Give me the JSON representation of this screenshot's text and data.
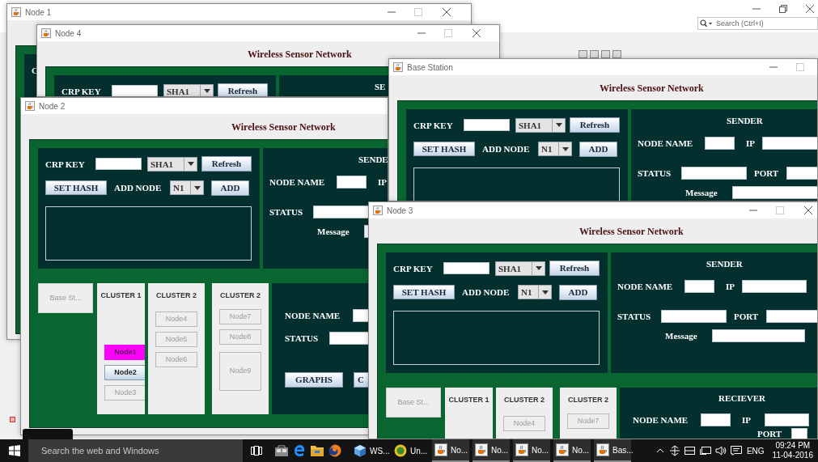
{
  "background_window": {
    "search": {
      "placeholder": "Search (Ctrl+I)"
    }
  },
  "windows": [
    {
      "title": "Node 1",
      "crp": {
        "key_label": "C"
      }
    },
    {
      "title": "Node 4",
      "heading": "Wireless Sensor Network",
      "crp": {
        "key_label": "CRP KEY",
        "hash_combo": "SHA1",
        "refresh_button": "Refresh"
      },
      "sender": {
        "title": "SE"
      }
    },
    {
      "title": "Node 2",
      "heading": "Wireless Sensor Network",
      "crp": {
        "key_label": "CRP KEY",
        "hash_combo": "SHA1",
        "refresh_button": "Refresh",
        "set_hash_button": "SET HASH",
        "add_node_label": "ADD NODE",
        "node_combo": "N1",
        "add_button": "ADD"
      },
      "sender": {
        "title": "SENDE",
        "node_name_label": "NODE NAME",
        "ip_label": "IP",
        "status_label": "STATUS",
        "message_label": "Message"
      },
      "bottom": {
        "base_button": "Base St...",
        "clusters": [
          {
            "title": "CLUSTER 1",
            "nodes": [
              {
                "label": "Node1",
                "highlighted": true,
                "disabled": false,
                "kind": "normal"
              },
              {
                "label": "Node2",
                "highlighted": false,
                "disabled": false,
                "kind": "normal"
              },
              {
                "label": "Node3",
                "highlighted": false,
                "disabled": true,
                "kind": "normal"
              }
            ]
          },
          {
            "title": "CLUSTER 2",
            "nodes": [
              {
                "label": "Node4",
                "highlighted": false,
                "disabled": true,
                "kind": "normal"
              },
              {
                "label": "Node5",
                "highlighted": false,
                "disabled": true,
                "kind": "normal"
              },
              {
                "label": "Node6",
                "highlighted": false,
                "disabled": true,
                "kind": "normal"
              }
            ]
          },
          {
            "title": "CLUSTER 2",
            "nodes": [
              {
                "label": "Node7",
                "highlighted": false,
                "disabled": true,
                "kind": "normal"
              },
              {
                "label": "Node8",
                "highlighted": false,
                "disabled": true,
                "kind": "normal"
              },
              {
                "label": "Node9",
                "highlighted": false,
                "disabled": true,
                "kind": "tall"
              }
            ]
          }
        ],
        "receiver": {
          "node_name_label": "NODE NAME",
          "status_label": "STATUS",
          "graphs_button": "GRAPHS",
          "other_button": "C"
        }
      }
    },
    {
      "title": "Base Station",
      "heading": "Wireless Sensor Network",
      "crp": {
        "key_label": "CRP KEY",
        "hash_combo": "SHA1",
        "refresh_button": "Refresh",
        "set_hash_button": "SET HASH",
        "add_node_label": "ADD NODE",
        "node_combo": "N1",
        "add_button": "ADD"
      },
      "sender": {
        "title": "SENDER",
        "node_name_label": "NODE NAME",
        "ip_label": "IP",
        "status_label": "STATUS",
        "port_label": "PORT",
        "message_label": "Message"
      }
    },
    {
      "title": "Node 3",
      "heading": "Wireless Sensor Network",
      "crp": {
        "key_label": "CRP KEY",
        "hash_combo": "SHA1",
        "refresh_button": "Refresh",
        "set_hash_button": "SET HASH",
        "add_node_label": "ADD NODE",
        "node_combo": "N1",
        "add_button": "ADD"
      },
      "sender": {
        "title": "SENDER",
        "node_name_label": "NODE NAME",
        "ip_label": "IP",
        "status_label": "STATUS",
        "port_label": "PORT",
        "message_label": "Message"
      },
      "bottom": {
        "base_button": "Base St...",
        "clusters": [
          {
            "title": "CLUSTER 1"
          },
          {
            "title": "CLUSTER 2",
            "nodes": [
              {
                "label": "Node4",
                "highlighted": false,
                "disabled": true,
                "kind": "normal"
              }
            ]
          },
          {
            "title": "CLUSTER 2",
            "nodes": [
              {
                "label": "Node7",
                "highlighted": false,
                "disabled": true,
                "kind": "normal"
              }
            ]
          }
        ],
        "receiver": {
          "title": "RECIEVER",
          "node_name_label": "NODE NAME",
          "ip_label": "IP",
          "port_label": "PORT"
        }
      }
    }
  ],
  "taskbar": {
    "search": {
      "placeholder": "Search the web and Windows"
    },
    "apps": [
      {
        "kind": "cube",
        "label": "WS..."
      },
      {
        "kind": "hs",
        "label": "Un..."
      },
      {
        "kind": "java",
        "label": "No..."
      },
      {
        "kind": "java",
        "label": "No..."
      },
      {
        "kind": "java",
        "label": "No..."
      },
      {
        "kind": "java",
        "label": "No..."
      },
      {
        "kind": "java",
        "label": "Bas..."
      }
    ],
    "language": "ENG",
    "time": "09:24 PM",
    "date": "11-04-2016"
  }
}
